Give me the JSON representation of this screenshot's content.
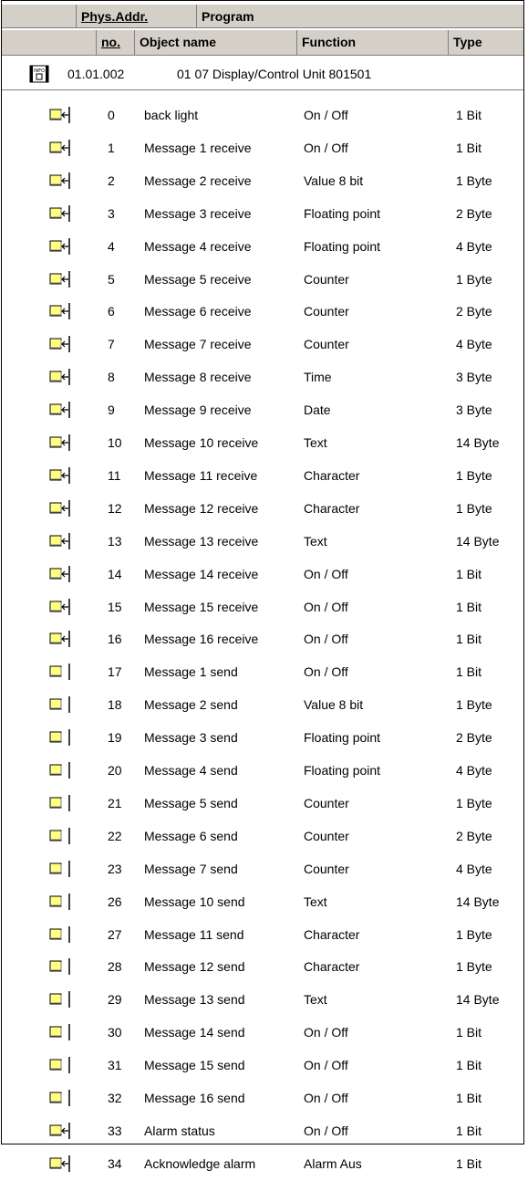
{
  "header": {
    "phys_addr": "Phys.Addr.",
    "program": "Program",
    "no": "no.",
    "object_name": "Object name",
    "function": "Function",
    "type": "Type"
  },
  "group": {
    "icon": "info-device-icon",
    "icon_text": "INFO",
    "address": "01.01.002",
    "name": "01 07 Display/Control Unit 801501"
  },
  "colors": {
    "object_icon_fill": "#ffff80",
    "header_bg": "#d4d0c8"
  },
  "objects": [
    {
      "icon": "receive",
      "no": "0",
      "name": "back light",
      "function": "On / Off",
      "type": "1 Bit"
    },
    {
      "icon": "receive",
      "no": "1",
      "name": "Message 1 receive",
      "function": "On / Off",
      "type": "1 Bit"
    },
    {
      "icon": "receive",
      "no": "2",
      "name": "Message 2 receive",
      "function": "Value 8 bit",
      "type": "1 Byte"
    },
    {
      "icon": "receive",
      "no": "3",
      "name": "Message 3 receive",
      "function": "Floating point",
      "type": "2 Byte"
    },
    {
      "icon": "receive",
      "no": "4",
      "name": "Message 4 receive",
      "function": "Floating point",
      "type": "4 Byte"
    },
    {
      "icon": "receive",
      "no": "5",
      "name": "Message 5 receive",
      "function": "Counter",
      "type": "1 Byte"
    },
    {
      "icon": "receive",
      "no": "6",
      "name": "Message 6 receive",
      "function": "Counter",
      "type": "2 Byte"
    },
    {
      "icon": "receive",
      "no": "7",
      "name": "Message 7 receive",
      "function": "Counter",
      "type": "4 Byte"
    },
    {
      "icon": "receive",
      "no": "8",
      "name": "Message 8 receive",
      "function": "Time",
      "type": "3 Byte"
    },
    {
      "icon": "receive",
      "no": "9",
      "name": "Message 9 receive",
      "function": "Date",
      "type": "3 Byte"
    },
    {
      "icon": "receive",
      "no": "10",
      "name": "Message 10 receive",
      "function": "Text",
      "type": "14 Byte"
    },
    {
      "icon": "receive",
      "no": "11",
      "name": "Message 11 receive",
      "function": "Character",
      "type": "1 Byte"
    },
    {
      "icon": "receive",
      "no": "12",
      "name": "Message 12 receive",
      "function": "Character",
      "type": "1 Byte"
    },
    {
      "icon": "receive",
      "no": "13",
      "name": "Message 13 receive",
      "function": "Text",
      "type": "14 Byte"
    },
    {
      "icon": "receive",
      "no": "14",
      "name": "Message 14 receive",
      "function": "On / Off",
      "type": "1 Bit"
    },
    {
      "icon": "receive",
      "no": "15",
      "name": "Message 15 receive",
      "function": "On / Off",
      "type": "1 Bit"
    },
    {
      "icon": "receive",
      "no": "16",
      "name": "Message 16 receive",
      "function": "On / Off",
      "type": "1 Bit"
    },
    {
      "icon": "send",
      "no": "17",
      "name": "Message 1 send",
      "function": "On / Off",
      "type": "1 Bit"
    },
    {
      "icon": "send",
      "no": "18",
      "name": "Message 2 send",
      "function": "Value 8 bit",
      "type": "1 Byte"
    },
    {
      "icon": "send",
      "no": "19",
      "name": "Message 3 send",
      "function": "Floating point",
      "type": "2 Byte"
    },
    {
      "icon": "send",
      "no": "20",
      "name": "Message 4 send",
      "function": "Floating point",
      "type": "4 Byte"
    },
    {
      "icon": "send",
      "no": "21",
      "name": "Message 5 send",
      "function": "Counter",
      "type": "1 Byte"
    },
    {
      "icon": "send",
      "no": "22",
      "name": "Message 6 send",
      "function": "Counter",
      "type": "2 Byte"
    },
    {
      "icon": "send",
      "no": "23",
      "name": "Message 7 send",
      "function": "Counter",
      "type": "4 Byte"
    },
    {
      "icon": "send",
      "no": "26",
      "name": "Message 10 send",
      "function": "Text",
      "type": "14 Byte"
    },
    {
      "icon": "send",
      "no": "27",
      "name": "Message 11 send",
      "function": "Character",
      "type": "1 Byte"
    },
    {
      "icon": "send",
      "no": "28",
      "name": "Message 12 send",
      "function": "Character",
      "type": "1 Byte"
    },
    {
      "icon": "send",
      "no": "29",
      "name": "Message 13 send",
      "function": "Text",
      "type": "14 Byte"
    },
    {
      "icon": "send",
      "no": "30",
      "name": "Message 14 send",
      "function": "On / Off",
      "type": "1 Bit"
    },
    {
      "icon": "send",
      "no": "31",
      "name": "Message 15 send",
      "function": "On / Off",
      "type": "1 Bit"
    },
    {
      "icon": "send",
      "no": "32",
      "name": "Message 16 send",
      "function": "On / Off",
      "type": "1 Bit"
    },
    {
      "icon": "receive",
      "no": "33",
      "name": "Alarm status",
      "function": "On / Off",
      "type": "1 Bit"
    },
    {
      "icon": "receive",
      "no": "34",
      "name": "Acknowledge alarm",
      "function": "Alarm Aus",
      "type": "1 Bit"
    }
  ]
}
